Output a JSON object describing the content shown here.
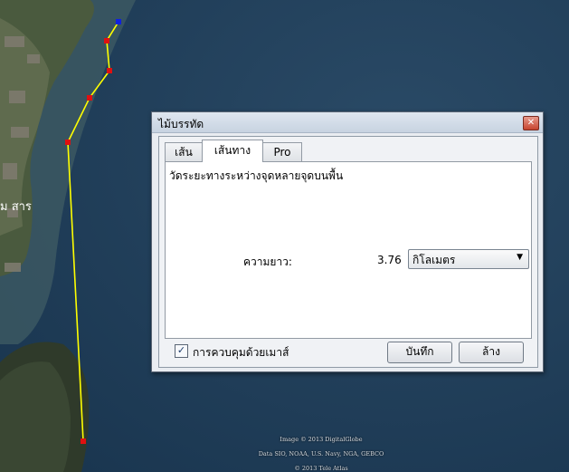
{
  "map": {
    "place_label": "ม สาร",
    "attribution": [
      "Image © 2013 DigitalGlobe",
      "Data SIO, NOAA, U.S. Navy, NGA, GEBCO",
      "© 2013 Tele Atlas"
    ]
  },
  "dialog": {
    "title": "ไม้บรรทัด",
    "close_icon": "close-icon",
    "tabs": [
      {
        "label": "เส้น",
        "active": false
      },
      {
        "label": "เส้นทาง",
        "active": true
      },
      {
        "label": "Pro",
        "active": false
      }
    ],
    "description": "วัดระยะทางระหว่างจุดหลายจุดบนพื้น",
    "length_label": "ความยาว:",
    "length_value": "3.76",
    "unit": {
      "selected": "กิโลเมตร",
      "arrow_icon": "dropdown-arrow-icon"
    },
    "mouse_navigation": {
      "label": "การควบคุมด้วยเมาส์",
      "checked": true
    },
    "save_label": "บันทึก",
    "clear_label": "ล้าง"
  },
  "colors": {
    "path": "#ffff00",
    "waypoint": "#e01010",
    "endpoint": "#1020e0",
    "sea": "#1f3d58"
  }
}
